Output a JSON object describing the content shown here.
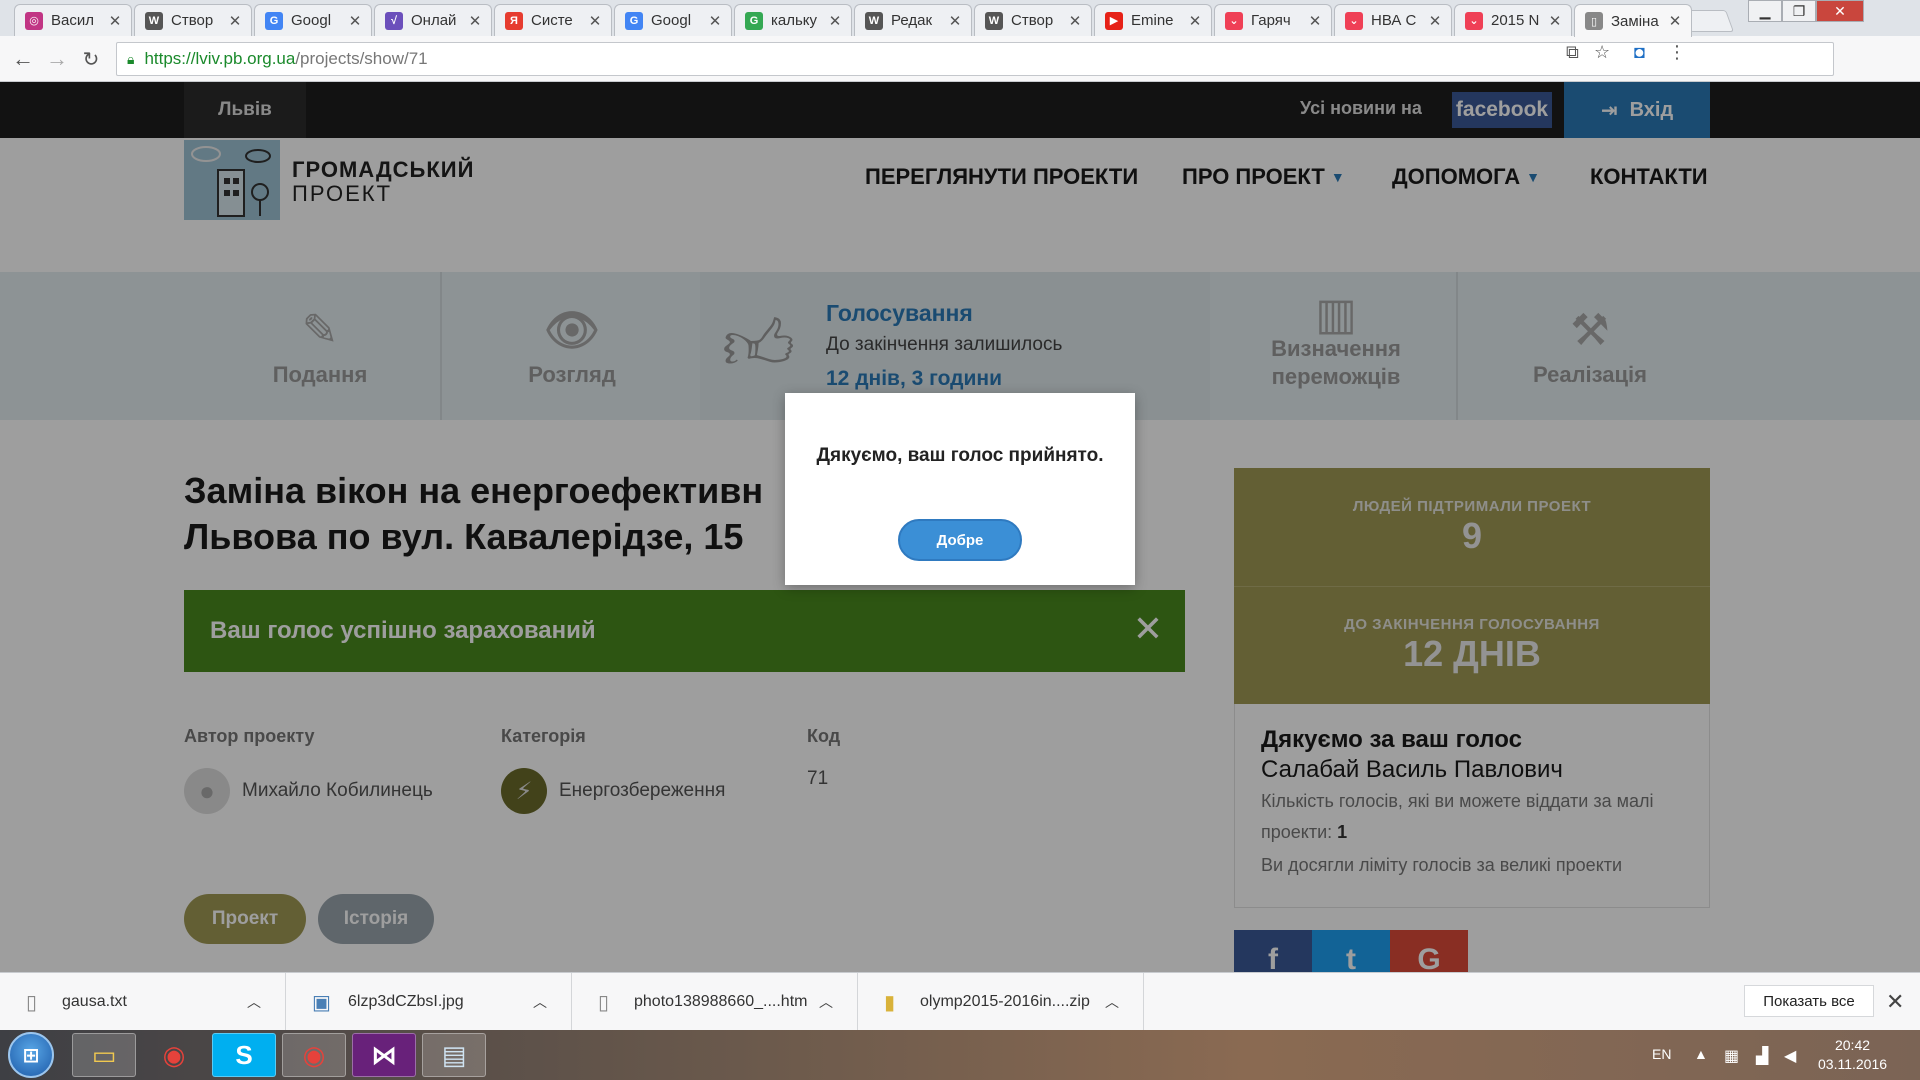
{
  "browser": {
    "tabs": [
      {
        "title": "Васил",
        "icon": "instagram-icon",
        "color": "#c13584",
        "glyph": "◎"
      },
      {
        "title": "Створ",
        "icon": "wikipedia-icon",
        "color": "#555555",
        "glyph": "W"
      },
      {
        "title": "Googl",
        "icon": "google-translate-icon",
        "color": "#4285f4",
        "glyph": "G"
      },
      {
        "title": "Онлай",
        "icon": "math-icon",
        "color": "#6b4fbb",
        "glyph": "√"
      },
      {
        "title": "Систе",
        "icon": "yandex-icon",
        "color": "#e63c2f",
        "glyph": "Я"
      },
      {
        "title": "Googl",
        "icon": "google-translate-icon",
        "color": "#4285f4",
        "glyph": "G"
      },
      {
        "title": "кальку",
        "icon": "google-icon",
        "color": "#34a853",
        "glyph": "G"
      },
      {
        "title": "Редак",
        "icon": "wikipedia-icon",
        "color": "#555555",
        "glyph": "W"
      },
      {
        "title": "Створ",
        "icon": "wikipedia-icon",
        "color": "#555555",
        "glyph": "W"
      },
      {
        "title": "Emine",
        "icon": "youtube-icon",
        "color": "#e62117",
        "glyph": "▶"
      },
      {
        "title": "Гаряч",
        "icon": "pocket-icon",
        "color": "#ef4056",
        "glyph": "⌄"
      },
      {
        "title": "НВА С",
        "icon": "pocket-icon",
        "color": "#ef4056",
        "glyph": "⌄"
      },
      {
        "title": "2015 N",
        "icon": "pocket-icon",
        "color": "#ef4056",
        "glyph": "⌄"
      },
      {
        "title": "Заміна",
        "icon": "page-icon",
        "color": "#888888",
        "glyph": "▯"
      }
    ],
    "url_host": "https://lviv.pb.org.ua",
    "url_path": "/projects/show/71"
  },
  "header": {
    "city": "Львів",
    "fb_news": "Усі новини на",
    "fb_badge": "facebook",
    "login": "Вхід",
    "logo_line1": "ГРОМАДСЬКИЙ",
    "logo_line2": "ПРОЕКТ",
    "nav": [
      "ПЕРЕГЛЯНУТИ ПРОЕКТИ",
      "ПРО ПРОЕКТ",
      "ДОПОМОГА",
      "КОНТАКТИ"
    ]
  },
  "stages": {
    "submission": "Подання",
    "review": "Розгляд",
    "voting_title": "Голосування",
    "voting_sub": "До закінчення залишилось",
    "voting_time": "12 днів, 3 години",
    "winners_1": "Визначення",
    "winners_2": "переможців",
    "implementation": "Реалізація"
  },
  "project": {
    "title_line1": "Заміна вікон на енергоефективн",
    "title_line2": "Львова по вул. Кавалерідзе, 15",
    "success_message": "Ваш голос успішно зарахований",
    "author_label": "Автор проекту",
    "author": "Михайло Кобилинець",
    "category_label": "Категорія",
    "category": "Енергозбереження",
    "code_label": "Код",
    "code": "71",
    "tab_project": "Проект",
    "tab_history": "Історія"
  },
  "sidebar": {
    "supporters_label": "ЛЮДЕЙ ПІДТРИМАЛИ ПРОЕКТ",
    "supporters": "9",
    "deadline_label": "ДО ЗАКІНЧЕННЯ ГОЛОСУВАННЯ",
    "deadline": "12 ДНІВ",
    "thanks_title": "Дякуємо за ваш голос",
    "voter_name": "Салабай Василь Павлович",
    "votes_text": "Кількість голосів, які ви можете віддати за малі проекти:",
    "votes_small": "1",
    "limit_text": "Ви досягли ліміту голосів за великі проекти"
  },
  "modal": {
    "message": "Дякуємо, ваш голос прийнято.",
    "ok": "Добре"
  },
  "downloads": {
    "items": [
      "gausa.txt",
      "6lzp3dCZbsI.jpg",
      "photo138988660_....htm",
      "olymp2015-2016in....zip"
    ],
    "show_all": "Показать все"
  },
  "taskbar": {
    "lang": "EN",
    "time": "20:42",
    "date": "03.11.2016"
  },
  "colors": {
    "accent": "#2a7ab7",
    "success": "#4a8a1e",
    "olive": "#a19a55"
  }
}
